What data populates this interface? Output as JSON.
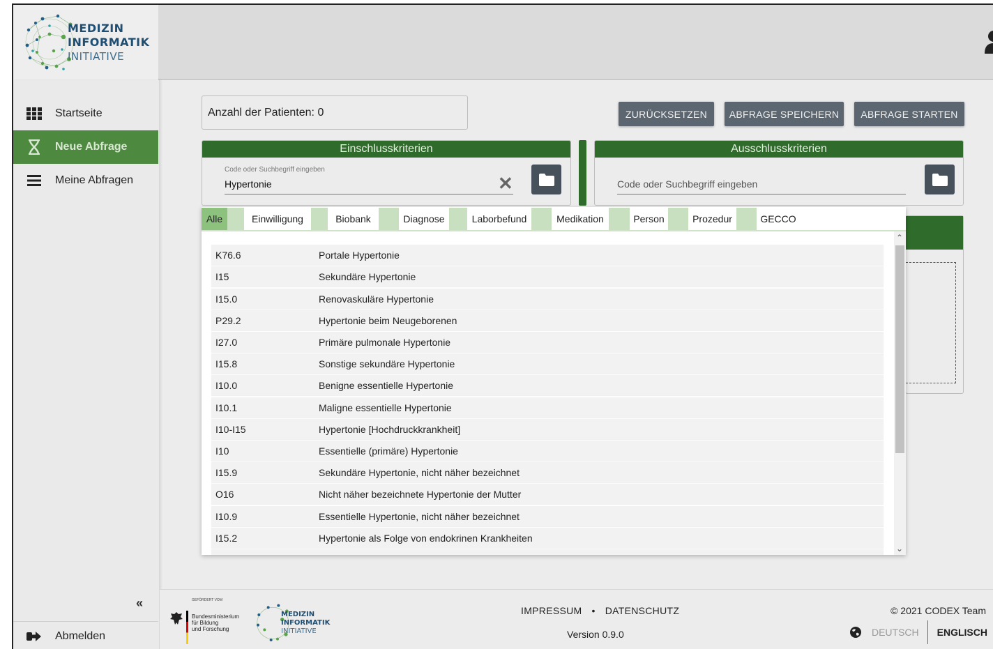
{
  "header": {
    "logo_line1": "MEDIZIN",
    "logo_line2": "INFORMATIK",
    "logo_line3": "INITIATIVE",
    "user_icon": "person-icon"
  },
  "sidebar": {
    "items": [
      {
        "label": "Startseite",
        "icon": "grid-icon"
      },
      {
        "label": "Neue Abfrage",
        "icon": "dna-icon",
        "active": true
      },
      {
        "label": "Meine Abfragen",
        "icon": "menu-icon"
      }
    ],
    "collapse_label": "«",
    "logout_label": "Abmelden"
  },
  "main": {
    "patient_count": "Anzahl der Patienten: 0",
    "buttons": {
      "reset": "ZURÜCKSETZEN",
      "save": "ABFRAGE SPEICHERN",
      "start": "ABFRAGE STARTEN"
    },
    "inclusion": {
      "title": "Einschlusskriterien",
      "field_label": "Code oder Suchbegriff eingeben",
      "value": "Hypertonie"
    },
    "exclusion": {
      "title": "Ausschlusskriterien",
      "placeholder": "Code oder Suchbegriff eingeben"
    }
  },
  "dropdown": {
    "tabs": [
      "Alle",
      "Einwilligung",
      "Biobank",
      "Diagnose",
      "Laborbefund",
      "Medikation",
      "Person",
      "Prozedur",
      "GECCO"
    ],
    "active_tab": "Alle",
    "results": [
      {
        "code": "K76.6",
        "desc": "Portale Hypertonie"
      },
      {
        "code": "I15",
        "desc": "Sekundäre Hypertonie"
      },
      {
        "code": "I15.0",
        "desc": "Renovaskuläre Hypertonie"
      },
      {
        "code": "P29.2",
        "desc": "Hypertonie beim Neugeborenen"
      },
      {
        "code": "I27.0",
        "desc": "Primäre pulmonale Hypertonie"
      },
      {
        "code": "I15.8",
        "desc": "Sonstige sekundäre Hypertonie"
      },
      {
        "code": "I10.0",
        "desc": "Benigne essentielle Hypertonie"
      },
      {
        "code": "I10.1",
        "desc": "Maligne essentielle Hypertonie"
      },
      {
        "code": "I10-I15",
        "desc": "Hypertonie [Hochdruckkrankheit]"
      },
      {
        "code": "I10",
        "desc": "Essentielle (primäre) Hypertonie"
      },
      {
        "code": "I15.9",
        "desc": "Sekundäre Hypertonie, nicht näher bezeichnet"
      },
      {
        "code": "O16",
        "desc": "Nicht näher bezeichnete Hypertonie der Mutter"
      },
      {
        "code": "I10.9",
        "desc": "Essentielle Hypertonie, nicht näher bezeichnet"
      },
      {
        "code": "I15.2",
        "desc": "Hypertonie als Folge von endokrinen Krankheiten"
      }
    ]
  },
  "footer": {
    "funded_by": "GEFÖRDERT VOM",
    "ministry_l1": "Bundesministerium",
    "ministry_l2": "für Bildung",
    "ministry_l3": "und Forschung",
    "logo_line1": "MEDIZIN",
    "logo_line2": "INFORMATIK",
    "logo_line3": "INITIATIVE",
    "impressum": "IMPRESSUM",
    "separator": "•",
    "datenschutz": "DATENSCHUTZ",
    "version": "Version 0.9.0",
    "copyright": "© 2021 CODEX Team",
    "lang_de": "DEUTSCH",
    "lang_en": "ENGLISCH"
  },
  "colors": {
    "brand_green": "#2f6b2a",
    "active_green": "#4d8a3f",
    "button_gray": "#5b6670"
  }
}
